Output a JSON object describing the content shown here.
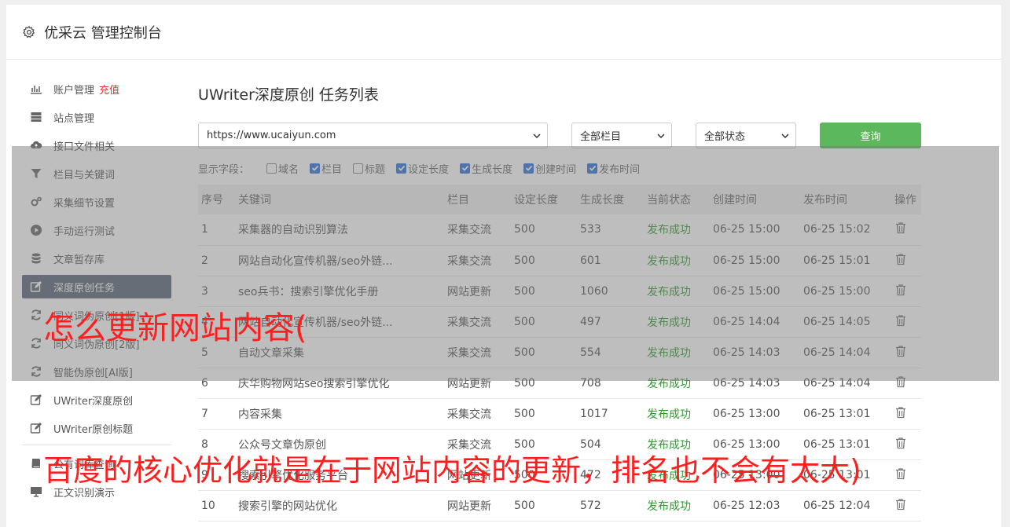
{
  "header": {
    "title": "优采云 管理控制台",
    "icon": "gear-icon"
  },
  "sidebar": {
    "items": [
      {
        "label": "账户管理",
        "extra": "充值",
        "icon": "bar-chart-icon"
      },
      {
        "label": "站点管理",
        "icon": "server-icon"
      },
      {
        "label": "接口文件相关",
        "icon": "cloud-upload-icon"
      },
      {
        "label": "栏目与关键词",
        "icon": "filter-icon"
      },
      {
        "label": "采集细节设置",
        "icon": "cogs-icon"
      },
      {
        "label": "手动运行测试",
        "icon": "play-circle-icon"
      },
      {
        "label": "文章暂存库",
        "icon": "database-icon"
      },
      {
        "label": "深度原创任务",
        "icon": "edit-icon",
        "active": true
      },
      {
        "label": "同义词伪原创[1版]",
        "icon": "refresh-icon"
      },
      {
        "label": "同义词伪原创[2版]",
        "icon": "refresh-icon"
      },
      {
        "label": "智能伪原创[AI版]",
        "icon": "refresh-icon"
      },
      {
        "label": "UWriter深度原创",
        "icon": "edit-icon"
      },
      {
        "label": "UWriter原创标题",
        "icon": "edit-icon"
      },
      {
        "label": "公有词库查询",
        "icon": "book-icon"
      },
      {
        "label": "正文识别演示",
        "icon": "monitor-icon"
      }
    ]
  },
  "main": {
    "title": "UWriter深度原创 任务列表",
    "site_select": "https://www.ucaiyun.com",
    "column_select": "全部栏目",
    "status_select": "全部状态",
    "query_button": "查询",
    "fields_label": "显示字段：",
    "fields": [
      {
        "label": "域名",
        "checked": false
      },
      {
        "label": "栏目",
        "checked": true
      },
      {
        "label": "标题",
        "checked": false
      },
      {
        "label": "设定长度",
        "checked": true
      },
      {
        "label": "生成长度",
        "checked": true
      },
      {
        "label": "创建时间",
        "checked": true
      },
      {
        "label": "发布时间",
        "checked": true
      }
    ],
    "table": {
      "headers": [
        "序号",
        "关键词",
        "栏目",
        "设定长度",
        "生成长度",
        "当前状态",
        "创建时间",
        "发布时间",
        "操作"
      ],
      "rows": [
        [
          "1",
          "采集器的自动识别算法",
          "采集交流",
          "500",
          "533",
          "发布成功",
          "06-25 15:00",
          "06-25 15:02"
        ],
        [
          "2",
          "网站自动化宣传机器/seo外链...",
          "采集交流",
          "500",
          "601",
          "发布成功",
          "06-25 15:00",
          "06-25 15:01"
        ],
        [
          "3",
          "seo兵书：搜索引擎优化手册",
          "网站更新",
          "500",
          "1060",
          "发布成功",
          "06-25 15:00",
          "06-25 15:00"
        ],
        [
          "4",
          "网站自动化宣传机器/seo外链...",
          "采集交流",
          "500",
          "497",
          "发布成功",
          "06-25 14:04",
          "06-25 14:05"
        ],
        [
          "5",
          "自动文章采集",
          "采集交流",
          "500",
          "554",
          "发布成功",
          "06-25 14:03",
          "06-25 14:04"
        ],
        [
          "6",
          "庆华购物网站seo搜索引擎优化",
          "网站更新",
          "500",
          "708",
          "发布成功",
          "06-25 14:03",
          "06-25 14:04"
        ],
        [
          "7",
          "内容采集",
          "采集交流",
          "500",
          "1017",
          "发布成功",
          "06-25 13:00",
          "06-25 13:01"
        ],
        [
          "8",
          "公众号文章伪原创",
          "采集交流",
          "500",
          "504",
          "发布成功",
          "06-25 13:00",
          "06-25 13:01"
        ],
        [
          "9",
          "搜索引擎优化服务平台",
          "网站更新",
          "500",
          "472",
          "发布成功",
          "06-25 13:00",
          "06-25 13:01"
        ],
        [
          "10",
          "搜索引擎的网站优化",
          "网站更新",
          "500",
          "572",
          "发布成功",
          "06-25 12:03",
          "06-25 12:04"
        ]
      ]
    }
  },
  "watermarks": {
    "line1": "怎么更新网站内容(",
    "line2": "百度的核心优化就是在于网站内容的更新，排名也不会有太大)"
  },
  "colors": {
    "accent_green": "#5cb85c",
    "active_nav": "#596575",
    "status_green": "#2e9a2e",
    "recharge_red": "#e03030",
    "watermark_red": "#ff1e1e"
  }
}
